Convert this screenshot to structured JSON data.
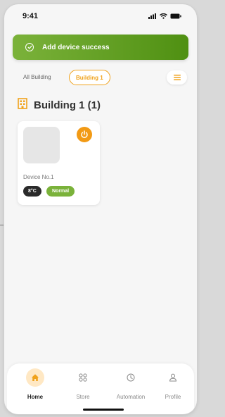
{
  "status_bar": {
    "time": "9:41",
    "icons": [
      "signal-icon",
      "wifi-icon",
      "battery-icon"
    ]
  },
  "toast": {
    "icon": "check-circle-icon",
    "message": "Add device success"
  },
  "tabs": {
    "all_label": "All Building",
    "active_label": "Building 1",
    "menu_icon": "menu-icon"
  },
  "section": {
    "title": "Building 1 (1)",
    "icon": "building-icon"
  },
  "device": {
    "name": "Device No.1",
    "temperature": "8°C",
    "status": "Normal",
    "power_icon": "power-icon"
  },
  "bottom_nav": {
    "items": [
      {
        "label": "Home",
        "icon": "home-icon",
        "active": true
      },
      {
        "label": "Store",
        "icon": "store-icon",
        "active": false
      },
      {
        "label": "Automation",
        "icon": "automation-icon",
        "active": false
      },
      {
        "label": "Profile",
        "icon": "profile-icon",
        "active": false
      }
    ]
  },
  "colors": {
    "accent": "#f0a21b",
    "success": "#5b9a16",
    "toast_gradient_start": "#7bb23a",
    "toast_gradient_end": "#4f9012",
    "dark_badge": "#2a2a2a"
  }
}
